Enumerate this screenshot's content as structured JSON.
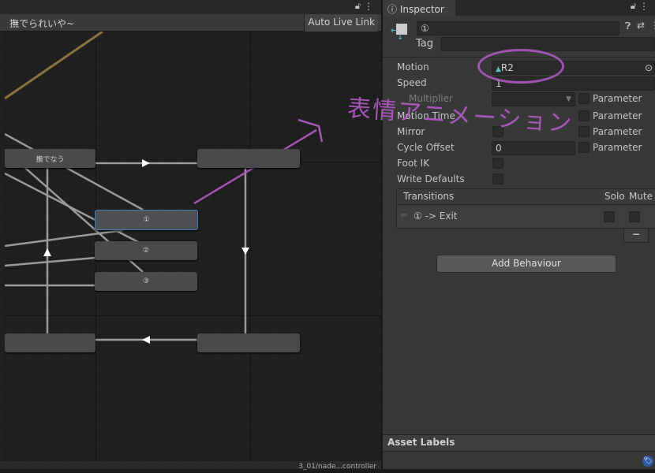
{
  "animator": {
    "breadcrumb": "撫でられいや~",
    "auto_live_link": "Auto Live Link",
    "status_path": "3_01/nade...controller",
    "nodes": {
      "nade_now": "撫でなう",
      "top_right": "",
      "state1": "①",
      "state2": "②",
      "state3": "③",
      "bottom_left": "",
      "bottom_right": ""
    }
  },
  "inspector": {
    "tab_label": "Inspector",
    "state_name": "①",
    "tag_label": "Tag",
    "tag_value": "",
    "fields": {
      "motion": {
        "label": "Motion",
        "value": "R2"
      },
      "speed": {
        "label": "Speed",
        "value": "1"
      },
      "multiplier": {
        "label": "Multiplier",
        "param": "Parameter"
      },
      "motion_time": {
        "label": "Motion Time",
        "param": "Parameter"
      },
      "mirror": {
        "label": "Mirror",
        "param": "Parameter"
      },
      "cycle_offset": {
        "label": "Cycle Offset",
        "value": "0",
        "param": "Parameter"
      },
      "foot_ik": {
        "label": "Foot IK"
      },
      "write_defaults": {
        "label": "Write Defaults"
      }
    },
    "transitions": {
      "header": "Transitions",
      "solo": "Solo",
      "mute": "Mute",
      "rows": [
        {
          "label": "① -> Exit"
        }
      ],
      "remove_label": "−"
    },
    "add_behaviour": "Add Behaviour",
    "asset_labels": "Asset Labels"
  },
  "annotation": {
    "handwritten": "表情アニメーション",
    "color": "#b35bc6"
  }
}
